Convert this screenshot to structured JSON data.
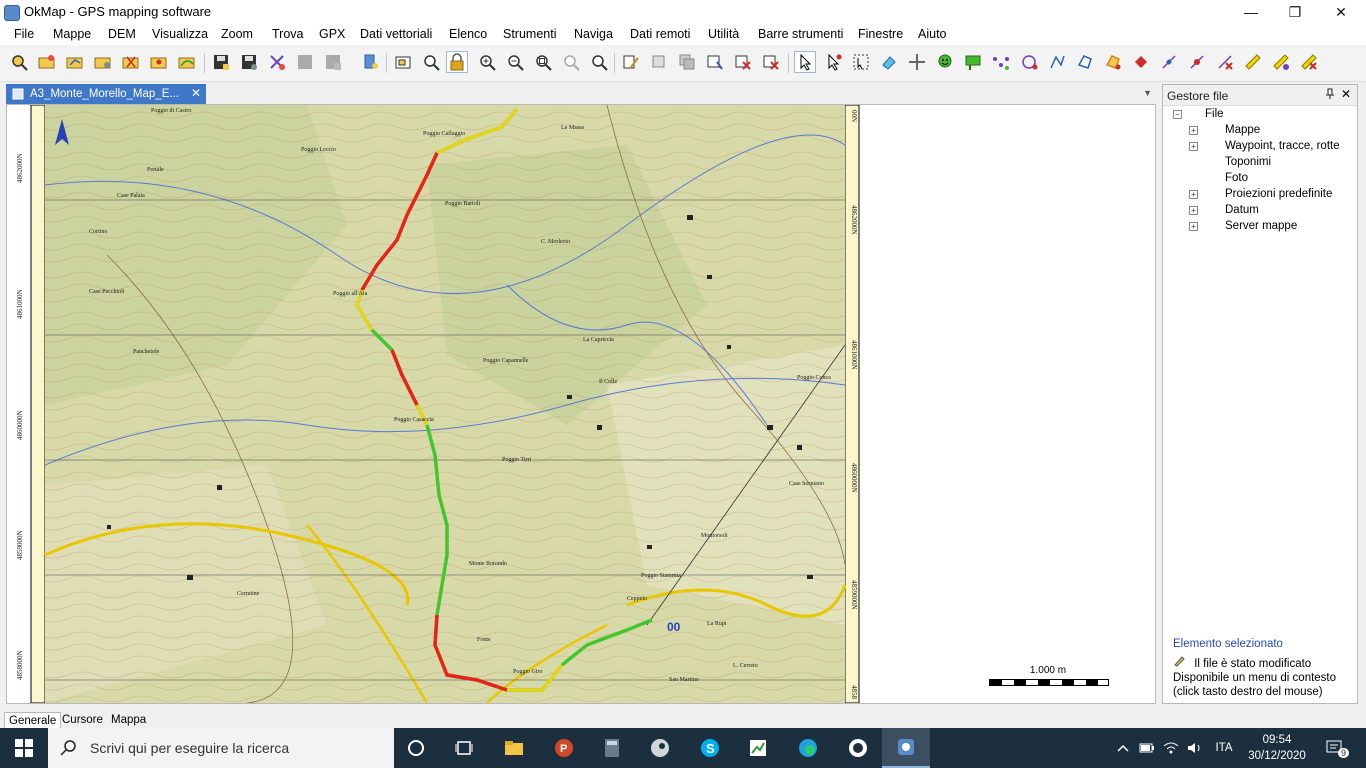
{
  "window": {
    "title": "OkMap - GPS mapping software",
    "minimize_glyph": "—",
    "maximize_glyph": "❐",
    "close_glyph": "✕"
  },
  "menu": [
    "File",
    "Mappe",
    "DEM",
    "Visualizza",
    "Zoom",
    "Trova",
    "GPX",
    "Dati vettoriali",
    "Elenco",
    "Strumenti",
    "Naviga",
    "Dati remoti",
    "Utilità",
    "Barre strumenti",
    "Finestre",
    "Aiuto"
  ],
  "document_tab": {
    "label": "A3_Monte_Morello_Map_E...",
    "close_glyph": "✕",
    "dropdown_glyph": "▼"
  },
  "map": {
    "north_labels": [
      "4862000N",
      "4861000N",
      "4860000N",
      "4859000N",
      "4858000N"
    ],
    "right_labels": [
      "00N",
      "4862000N",
      "4861000N",
      "4860000N",
      "4859000N",
      "4858"
    ],
    "place_labels": [
      "Poggio di Castro",
      "Poggio Caflaggio",
      "Le Masse",
      "Case Palaia",
      "Poggio Bartoli",
      "C. Morlecto",
      "Poggio all'Aia",
      "Poggio Casaccia",
      "Poggio Capannelle",
      "Poggio Conca",
      "Poggio Tirri",
      "Monte Rotondo",
      "Poggio Stammia",
      "Poggio Giro",
      "Case Sorniano",
      "La Rupi",
      "Poggio Leccio",
      "Pretale",
      "Cortino",
      "Case Pecchioli",
      "Panchetole",
      "Cerretine",
      "Ceppeto",
      "Montorsoli",
      "La Capriccia",
      "Il Colle",
      "Fonte",
      "San Martino",
      "L. Cerreto"
    ],
    "marker_label": "00",
    "scale_label": "1.000 m"
  },
  "file_manager": {
    "title": "Gestore file",
    "pin_glyph": "📌",
    "close_glyph": "✕",
    "root": "File",
    "items": [
      {
        "label": "Mappe",
        "expandable": true
      },
      {
        "label": "Waypoint, tracce, rotte",
        "expandable": true
      },
      {
        "label": "Toponimi",
        "expandable": false
      },
      {
        "label": "Foto",
        "expandable": false
      },
      {
        "label": "Proiezioni predefinite",
        "expandable": true
      },
      {
        "label": "Datum",
        "expandable": true
      },
      {
        "label": "Server mappe",
        "expandable": true
      }
    ],
    "selected_heading": "Elemento selezionato",
    "selected_status": "Il file è stato modificato",
    "context_note": "Disponibile un menu di contesto (click tasto destro del mouse)"
  },
  "bottom_tabs": [
    "Generale",
    "Cursore",
    "Mappa"
  ],
  "taskbar": {
    "search_placeholder": "Scrivi qui per eseguire la ricerca",
    "language": "ITA",
    "time": "09:54",
    "date": "30/12/2020",
    "notifications": "9"
  },
  "colors": {
    "track_red": "#e8231a",
    "track_yellow": "#e6d41a",
    "track_green": "#43c62c",
    "accent_blue": "#3f77c9",
    "map_base": "#d7d9a9"
  }
}
